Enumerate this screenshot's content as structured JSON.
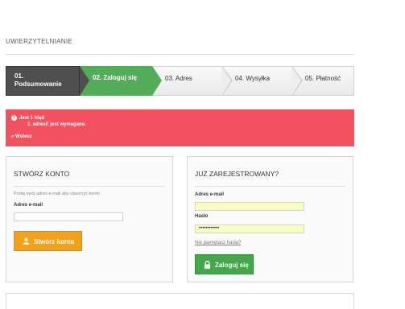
{
  "page": {
    "title": "UWIERZYTELNIANIE"
  },
  "steps": [
    {
      "num": "01.",
      "label": "Podsumowanie",
      "state": "done"
    },
    {
      "label": "02. Zaloguj się",
      "state": "current"
    },
    {
      "label": "03. Adres",
      "state": "todo"
    },
    {
      "label": "04. Wysyłka",
      "state": "todo"
    },
    {
      "label": "05. Płatność",
      "state": "todo"
    }
  ],
  "error": {
    "icon": "x-circle-icon",
    "heading": "Jest 1 błąd",
    "items": [
      "1. adresE jest wymagane."
    ],
    "back_link": "« Wstecz"
  },
  "create_account": {
    "title": "STWÓRZ KONTO",
    "note": "Podaj swój adres e-mail aby utworzyć konto",
    "email_label": "Adres e-mail",
    "email_value": "",
    "button_label": "Stwórz konto",
    "button_icon": "user-icon"
  },
  "login": {
    "title": "JUŻ ZAREJESTROWANY?",
    "email_label": "Adres e-mail",
    "email_value": "",
    "password_label": "Hasło",
    "password_value": "••••••••••••",
    "forgot_link": "Nie pamiętasz hasła?",
    "button_label": "Zaloguj się",
    "button_icon": "lock-icon"
  },
  "colors": {
    "accent_green": "#53ad58",
    "error_red": "#f2515f",
    "button_orange": "#f3a119",
    "step_done": "#4f4f4f"
  }
}
